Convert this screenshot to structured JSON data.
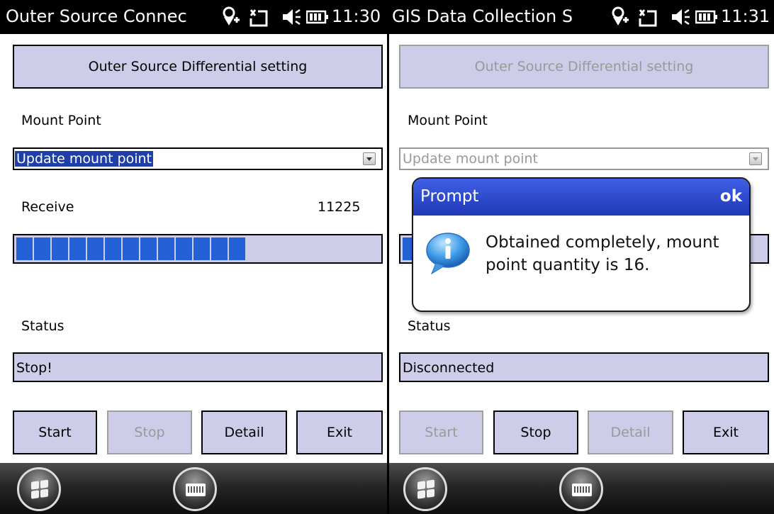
{
  "left": {
    "status_bar": {
      "title": "Outer Source Connec",
      "time": "11:30"
    },
    "setting_button": "Outer Source Differential setting",
    "mount_point_label": "Mount Point",
    "mount_point_value": "Update mount point",
    "receive_label": "Receive",
    "receive_value": "11225",
    "progress_segments": 13,
    "status_label": "Status",
    "status_value": "Stop!",
    "buttons": {
      "start": "Start",
      "stop": "Stop",
      "detail": "Detail",
      "exit": "Exit"
    },
    "enabled": {
      "start": true,
      "stop": false,
      "detail": true,
      "exit": true
    }
  },
  "right": {
    "status_bar": {
      "title": "GIS Data Collection S",
      "time": "11:31"
    },
    "setting_button": "Outer Source Differential setting",
    "mount_point_label": "Mount Point",
    "mount_point_value": "Update mount point",
    "status_label": "Status",
    "status_value": "Disconnected",
    "buttons": {
      "start": "Start",
      "stop": "Stop",
      "detail": "Detail",
      "exit": "Exit"
    },
    "enabled": {
      "start": false,
      "stop": true,
      "detail": false,
      "exit": true
    },
    "dialog": {
      "title": "Prompt",
      "ok": "ok",
      "message": "Obtained completely, mount point quantity is 16."
    }
  },
  "icons": [
    "gps-icon",
    "sync-icon",
    "volume-icon",
    "battery-icon",
    "windows-start-icon",
    "keyboard-icon",
    "info-icon"
  ],
  "colors": {
    "panel": "#cdcdea",
    "progress": "#2460d6",
    "dialog_header": "#2a47c8",
    "selection": "#1e3faa"
  }
}
